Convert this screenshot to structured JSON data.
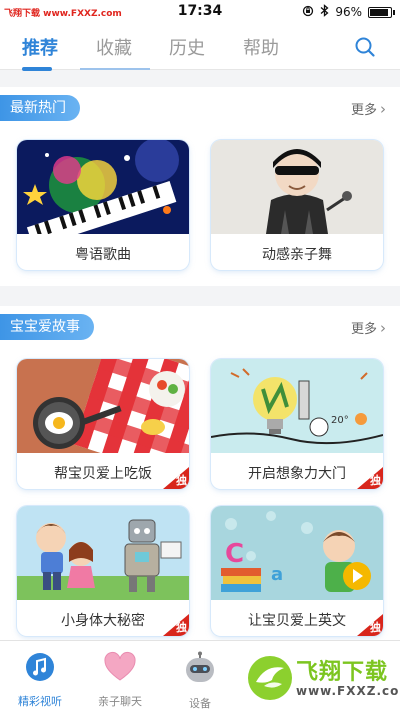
{
  "status_bar": {
    "watermark": "飞翔下载 www.FXXZ.com",
    "time": "17:34",
    "battery": "96%",
    "battery_level": 0.96
  },
  "top_tabs": [
    {
      "label": "推荐",
      "active": true
    },
    {
      "label": "收藏",
      "active": false
    },
    {
      "label": "历史",
      "active": false
    },
    {
      "label": "帮助",
      "active": false
    }
  ],
  "sections": [
    {
      "tag": "最新热门",
      "more": "更多",
      "cards": [
        {
          "title": "粤语歌曲",
          "exclusive": false
        },
        {
          "title": "动感亲子舞",
          "exclusive": false
        }
      ]
    },
    {
      "tag": "宝宝爱故事",
      "more": "更多",
      "cards": [
        {
          "title": "帮宝贝爱上吃饭",
          "exclusive": true,
          "badge": "独"
        },
        {
          "title": "开启想象力大门",
          "exclusive": true,
          "badge": "独"
        },
        {
          "title": "小身体大秘密",
          "exclusive": true,
          "badge": "独"
        },
        {
          "title": "让宝贝爱上英文",
          "exclusive": true,
          "badge": "独"
        }
      ]
    }
  ],
  "bottom_nav": [
    {
      "label": "精彩视听",
      "active": true
    },
    {
      "label": "亲子聊天",
      "active": false
    },
    {
      "label": "设备",
      "active": false
    }
  ],
  "watermark_bottom": {
    "text": "飞翔下载",
    "url": "www.FXXZ.com"
  },
  "colors": {
    "accent": "#2f84d8",
    "badge": "#d8261c",
    "watermark_green": "#7cc520"
  }
}
